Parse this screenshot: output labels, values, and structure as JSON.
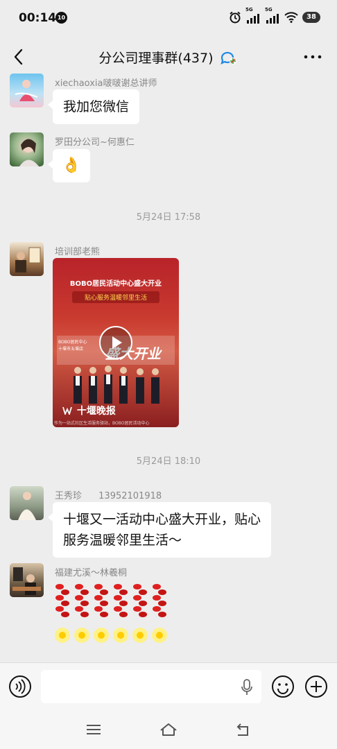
{
  "status_bar": {
    "time": "00:14",
    "notification_badge": "10",
    "battery": "38",
    "signal_1": "5G",
    "signal_2": "5G"
  },
  "header": {
    "title": "分公司理事群(437)",
    "back_icon": "chevron-left-icon",
    "more_icon": "more-dots-icon"
  },
  "messages": [
    {
      "sender": "xiechaoxia啵啵谢总讲师",
      "type": "text",
      "text": "我加您微信"
    },
    {
      "sender": "罗田分公司~何惠仁",
      "type": "emoji",
      "text": "👌"
    },
    {
      "type": "time",
      "text": "5月24日 17:58"
    },
    {
      "sender": "培训部老熊",
      "type": "video",
      "video": {
        "title": "BOBO居民活动中心盛大开业",
        "subtitle": "贴心服务温暖邻里生活",
        "banner_small_1": "BOBO居民中心",
        "banner_small_2": "十堰市五堰店",
        "banner_big": "盛大开业",
        "source": "十堰晚报",
        "caption": "作为一站式社区生活服务驿站，BOBO居民活动中心"
      }
    },
    {
      "type": "time",
      "text": "5月24日 18:10"
    },
    {
      "sender": "王秀珍",
      "phone": "13952101918",
      "type": "text",
      "lines": [
        "十堰又一活动中心盛大开业，贴心",
        "服务温暖邻里生活～"
      ]
    },
    {
      "sender": "福建尤溪～林羲桐",
      "type": "sticker",
      "count": 6
    }
  ],
  "input_bar": {
    "placeholder": "",
    "icons": [
      "voice-icon",
      "microphone-icon",
      "emoji-icon",
      "plus-icon"
    ]
  },
  "nav_bar": {
    "icons": [
      "menu-icon",
      "home-icon",
      "back-icon"
    ]
  },
  "colors": {
    "background": "#ededed",
    "bubble": "#ffffff",
    "sender_text": "#888888",
    "timestamp_text": "#9a9a9a",
    "video_red": "#c93a2f"
  }
}
